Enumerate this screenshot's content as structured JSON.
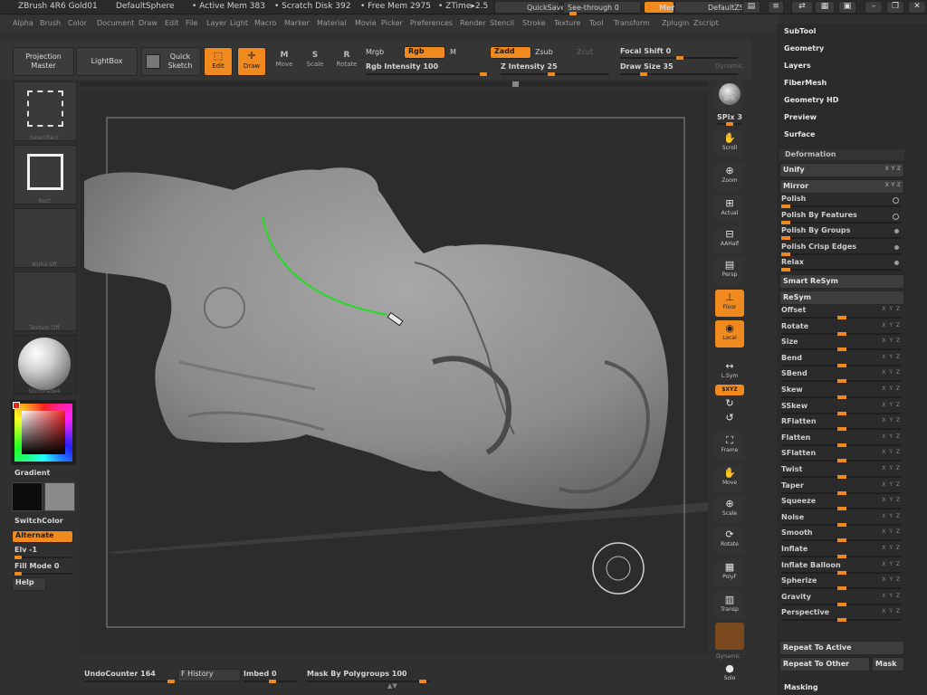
{
  "title_bar": {
    "app": "ZBrush 4R6 Gold01",
    "document": "DefaultSphere",
    "active_mem": "• Active Mem 383",
    "scratch_disk": "• Scratch Disk 392",
    "free_mem": "• Free Mem 2975",
    "ztime": "• ZTime▸2.5",
    "quicksave": "QuickSave",
    "see_through": "See-through  0",
    "menus": "Menus",
    "default_zscript": "DefaultZScript"
  },
  "menu_items": [
    "Alpha",
    "Brush",
    "Color",
    "Document",
    "Draw",
    "Edit",
    "File",
    "Layer",
    "Light",
    "Macro",
    "Marker",
    "Material",
    "Movie",
    "Picker",
    "Preferences",
    "Render",
    "Stencil",
    "Stroke",
    "Texture",
    "Tool",
    "Transform",
    "Zplugin",
    "Zscript"
  ],
  "toolbar": {
    "projection_master": "Projection Master",
    "lightbox": "LightBox",
    "quick_sketch": "Quick Sketch",
    "edit": "Edit",
    "draw": "Draw",
    "move": "Move",
    "scale": "Scale",
    "rotate": "Rotate",
    "mrgb": "Mrgb",
    "rgb": "Rgb",
    "m": "M",
    "rgb_intensity": "Rgb Intensity 100",
    "zadd": "Zadd",
    "zsub": "Zsub",
    "zcut": "Zcut",
    "z_intensity": "Z Intensity 25",
    "focal_shift": "Focal Shift 0",
    "draw_size": "Draw Size 35",
    "dynamic": "Dynamic"
  },
  "left_shelf": {
    "selectrect": "SelectRect",
    "rect": "Rect",
    "alpha_off": "Alpha Off",
    "texture_off": "Texture Off",
    "material": "SkinShade4",
    "gradient": "Gradient",
    "switchcolor": "SwitchColor",
    "alternate": "Alternate",
    "elv": "Elv -1",
    "fill_mode": "Fill Mode 0",
    "help": "Help"
  },
  "right_shelf": {
    "bpr": "BPR",
    "spix": "SPix 3",
    "scroll": "Scroll",
    "zoom": "Zoom",
    "actual": "Actual",
    "aahalf": "AAHalf",
    "persp": "Persp",
    "floor": "Floor",
    "local": "Local",
    "lsym": "L.Sym",
    "xyz": "$XYZ",
    "frame": "Frame",
    "move": "Move",
    "scale": "Scale",
    "rotate": "Rotate",
    "polyf": "PolyF",
    "transp": "Transp",
    "dynamic": "Dynamic",
    "solo": "Solo"
  },
  "right_panel": {
    "headers": [
      "SubTool",
      "Geometry",
      "Layers",
      "FiberMesh",
      "Geometry HD",
      "Preview",
      "Surface"
    ],
    "deformation_title": "Deformation",
    "unify": "Unify",
    "mirror": "Mirror",
    "polish_items": [
      "Polish",
      "Polish By Features",
      "Polish By Groups",
      "Polish Crisp Edges",
      "Relax"
    ],
    "smart_resym": "Smart ReSym",
    "resym": "ReSym",
    "deform_items": [
      "Offset",
      "Rotate",
      "Size",
      "Bend",
      "SBend",
      "Skew",
      "SSkew",
      "RFlatten",
      "Flatten",
      "SFlatten",
      "Twist",
      "Taper",
      "Squeeze",
      "Noise",
      "Smooth",
      "Inflate",
      "Inflate Balloon",
      "Spherize",
      "Gravity",
      "Perspective"
    ],
    "xyz_tag": "X Y Z",
    "repeat_to_active": "Repeat To Active",
    "repeat_to_other": "Repeat To Other",
    "mask": "Mask",
    "masking": "Masking"
  },
  "bottom_bar": {
    "undo_counter": "UndoCounter 164",
    "f_history": "F History",
    "imbed": "Imbed 0",
    "mask_by_polygroups": "Mask By Polygroups 100"
  },
  "colors": {
    "accent": "#f08a1e",
    "stroke": "#22dd22",
    "background": "#303030"
  }
}
